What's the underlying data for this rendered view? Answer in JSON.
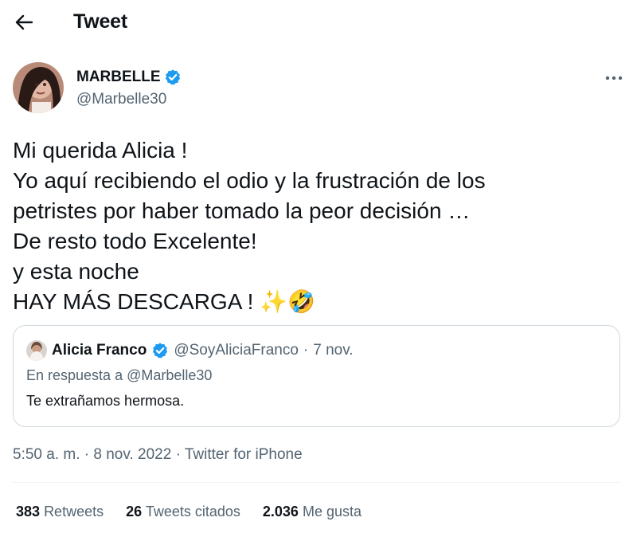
{
  "header": {
    "title": "Tweet",
    "back_icon": "arrow-left-icon"
  },
  "author": {
    "display_name": "MARBELLE",
    "handle": "@Marbelle30",
    "verified": true,
    "verified_color": "#1d9bf0"
  },
  "tweet": {
    "lines": [
      "Mi querida Alicia !",
      "Yo aquí recibiendo el odio y la frustración de los",
      "petristes por haber tomado la peor decisión …",
      "De resto todo Excelente!",
      "y esta noche",
      "HAY MÁS DESCARGA ! ✨🤣"
    ]
  },
  "quote": {
    "name": "Alicia Franco",
    "handle": "@SoyAliciaFranco",
    "separator": "·",
    "date": "7 nov.",
    "reply_to": "En respuesta a @Marbelle30",
    "text": "Te extrañamos hermosa."
  },
  "meta": {
    "time": "5:50 a. m.",
    "sep1": "·",
    "date": "8 nov. 2022",
    "sep2": "·",
    "source": "Twitter for iPhone"
  },
  "stats": {
    "retweets_count": "383",
    "retweets_label": "Retweets",
    "quotes_count": "26",
    "quotes_label": "Tweets citados",
    "likes_count": "2.036",
    "likes_label": "Me gusta"
  },
  "colors": {
    "text": "#0f1419",
    "secondary": "#536471",
    "border": "#cfd9de",
    "accent": "#1d9bf0"
  }
}
